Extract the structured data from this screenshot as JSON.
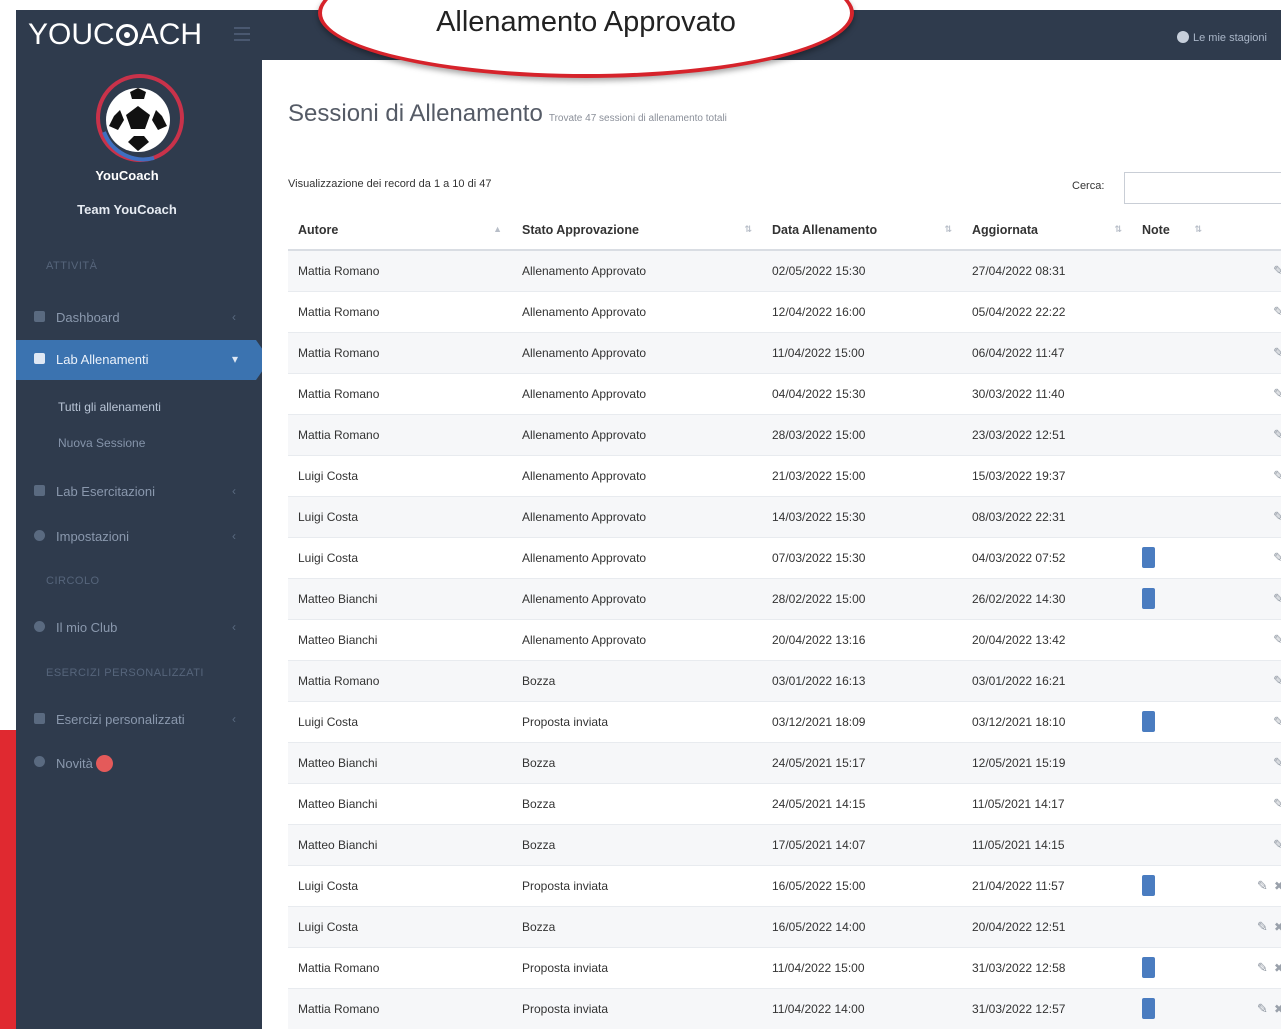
{
  "app": {
    "brand": "YOUC",
    "brand_tail": "ACH",
    "season_label": "Le mie stagioni"
  },
  "callout": {
    "text": "Allenamento Approvato"
  },
  "sidebar": {
    "team_short": "YouCoach",
    "team_name": "Team YouCoach",
    "sections": [
      "ATTIVITÀ",
      "CIRCOLO",
      "ESERCIZI PERSONALIZZATI"
    ],
    "items": [
      {
        "label": "Dashboard"
      },
      {
        "label": "Lab Allenamenti"
      },
      {
        "label": "Lab Esercitazioni"
      },
      {
        "label": "Impostazioni"
      },
      {
        "label": "Il mio Club"
      },
      {
        "label": "Esercizi personalizzati"
      },
      {
        "label": "Novità"
      }
    ],
    "subitems": [
      "Tutti gli allenamenti",
      "Nuova Sessione"
    ]
  },
  "main": {
    "title": "Sessioni di Allenamento",
    "subtitle": "Trovate 47 sessioni di allenamento totali",
    "records_info": "Visualizzazione dei record da 1 a 10 di 47",
    "search_label": "Cerca:",
    "search_value": ""
  },
  "table": {
    "columns": [
      "Autore",
      "Stato Approvazione",
      "Data Allenamento",
      "Aggiornata",
      "Note",
      ""
    ],
    "rows": [
      {
        "author": "Mattia Romano",
        "status": "Allenamento Approvato",
        "date": "02/05/2022 15:30",
        "updated": "27/04/2022 08:31",
        "note": false,
        "delete": false
      },
      {
        "author": "Mattia Romano",
        "status": "Allenamento Approvato",
        "date": "12/04/2022 16:00",
        "updated": "05/04/2022 22:22",
        "note": false,
        "delete": false
      },
      {
        "author": "Mattia Romano",
        "status": "Allenamento Approvato",
        "date": "11/04/2022 15:00",
        "updated": "06/04/2022 11:47",
        "note": false,
        "delete": false
      },
      {
        "author": "Mattia Romano",
        "status": "Allenamento Approvato",
        "date": "04/04/2022 15:30",
        "updated": "30/03/2022 11:40",
        "note": false,
        "delete": false
      },
      {
        "author": "Mattia Romano",
        "status": "Allenamento Approvato",
        "date": "28/03/2022 15:00",
        "updated": "23/03/2022 12:51",
        "note": false,
        "delete": false
      },
      {
        "author": "Luigi Costa",
        "status": "Allenamento Approvato",
        "date": "21/03/2022 15:00",
        "updated": "15/03/2022 19:37",
        "note": false,
        "delete": false
      },
      {
        "author": "Luigi Costa",
        "status": "Allenamento Approvato",
        "date": "14/03/2022 15:30",
        "updated": "08/03/2022 22:31",
        "note": false,
        "delete": false
      },
      {
        "author": "Luigi Costa",
        "status": "Allenamento Approvato",
        "date": "07/03/2022 15:30",
        "updated": "04/03/2022 07:52",
        "note": true,
        "delete": false
      },
      {
        "author": "Matteo Bianchi",
        "status": "Allenamento Approvato",
        "date": "28/02/2022 15:00",
        "updated": "26/02/2022 14:30",
        "note": true,
        "delete": false
      },
      {
        "author": "Matteo Bianchi",
        "status": "Allenamento Approvato",
        "date": "20/04/2022 13:16",
        "updated": "20/04/2022 13:42",
        "note": false,
        "delete": false
      },
      {
        "author": "Mattia Romano",
        "status": "Bozza",
        "date": "03/01/2022 16:13",
        "updated": "03/01/2022 16:21",
        "note": false,
        "delete": false
      },
      {
        "author": "Luigi Costa",
        "status": "Proposta inviata",
        "date": "03/12/2021 18:09",
        "updated": "03/12/2021 18:10",
        "note": true,
        "delete": false
      },
      {
        "author": "Matteo Bianchi",
        "status": "Bozza",
        "date": "24/05/2021 15:17",
        "updated": "12/05/2021 15:19",
        "note": false,
        "delete": false
      },
      {
        "author": "Matteo Bianchi",
        "status": "Bozza",
        "date": "24/05/2021 14:15",
        "updated": "11/05/2021 14:17",
        "note": false,
        "delete": false
      },
      {
        "author": "Matteo Bianchi",
        "status": "Bozza",
        "date": "17/05/2021 14:07",
        "updated": "11/05/2021 14:15",
        "note": false,
        "delete": false
      },
      {
        "author": "Luigi Costa",
        "status": "Proposta inviata",
        "date": "16/05/2022 15:00",
        "updated": "21/04/2022 11:57",
        "note": true,
        "delete": true
      },
      {
        "author": "Luigi Costa",
        "status": "Bozza",
        "date": "16/05/2022 14:00",
        "updated": "20/04/2022 12:51",
        "note": false,
        "delete": true
      },
      {
        "author": "Mattia Romano",
        "status": "Proposta inviata",
        "date": "11/04/2022 15:00",
        "updated": "31/03/2022 12:58",
        "note": true,
        "delete": true
      },
      {
        "author": "Mattia Romano",
        "status": "Proposta inviata",
        "date": "11/04/2022 14:00",
        "updated": "31/03/2022 12:57",
        "note": true,
        "delete": true
      }
    ]
  },
  "colors": {
    "sidebar_bg": "#2f3b4d",
    "active_item": "#3b73b0",
    "accent_red": "#e02930",
    "note_badge": "#4a7cc0"
  },
  "icons": [
    "soccer-ball-logo-icon",
    "season-icon",
    "dashboard-icon",
    "training-lab-icon",
    "exercise-lab-icon",
    "settings-icon",
    "club-icon",
    "custom-exercises-icon",
    "news-icon",
    "edit-icon",
    "delete-icon",
    "note-icon",
    "sort-icon"
  ]
}
